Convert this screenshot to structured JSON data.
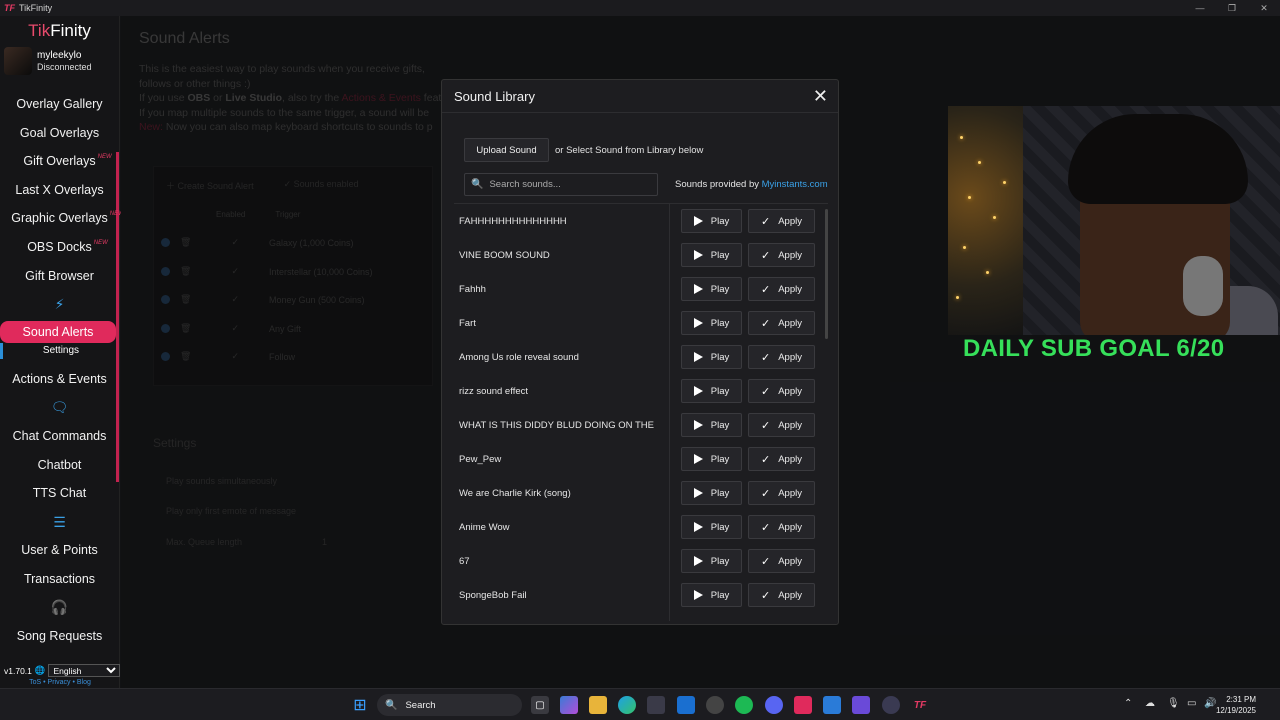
{
  "window": {
    "app_logo": "TF",
    "title": "TikFinity"
  },
  "sidebar": {
    "brand_tik": "Tik",
    "brand_finity": "Finity",
    "username": "myleekylo",
    "status": "Disconnected",
    "items": [
      {
        "label": "Overlay Gallery",
        "new": ""
      },
      {
        "label": "Goal Overlays",
        "new": ""
      },
      {
        "label": "Gift Overlays",
        "new": "NEW"
      },
      {
        "label": "Last X Overlays",
        "new": ""
      },
      {
        "label": "Graphic Overlays",
        "new": "NEW"
      },
      {
        "label": "OBS Docks",
        "new": "NEW"
      },
      {
        "label": "Gift Browser",
        "new": ""
      }
    ],
    "active_item": "Sound Alerts",
    "sub_item": "Settings",
    "items2": [
      {
        "label": "Actions & Events"
      }
    ],
    "items3": [
      {
        "label": "Chat Commands"
      },
      {
        "label": "Chatbot"
      },
      {
        "label": "TTS Chat"
      }
    ],
    "items4": [
      {
        "label": "User & Points"
      },
      {
        "label": "Transactions"
      }
    ],
    "items5": [
      {
        "label": "Song Requests"
      }
    ],
    "version": "v1.70.1",
    "language": "English",
    "link_tos": "ToS",
    "link_privacy": "Privacy",
    "link_blog": "Blog"
  },
  "background": {
    "title": "Sound Alerts",
    "desc_line1": "This is the easiest way to play sounds when you receive gifts, follows or other things :)",
    "desc_line2_a": "If you use ",
    "desc_line2_obs": "OBS",
    "desc_line2_b": " or ",
    "desc_line2_live": "Live Studio",
    "desc_line2_c": ", also try the ",
    "desc_line2_actions": "Actions & Events",
    "desc_line2_d": " feat",
    "desc_line3": "If you map multiple sounds to the same trigger, a sound will be",
    "desc_line4_new": "New:",
    "desc_line4": " Now you can also map keyboard shortcuts to sounds to p",
    "create_btn": "Create Sound Alert",
    "sounds_enabled": "Sounds enabled",
    "col_enabled": "Enabled",
    "col_trigger": "Trigger",
    "rows": [
      "Galaxy (1,000 Coins)",
      "Interstellar (10,000 Coins)",
      "Money Gun (500 Coins)",
      "Any Gift",
      "Follow"
    ],
    "settings_title": "Settings",
    "setting1": "Play sounds simultaneously",
    "setting2": "Play only first emote of message",
    "setting3": "Max. Queue length",
    "setting3_value": "1"
  },
  "modal": {
    "title": "Sound Library",
    "close": "✕",
    "upload_label": "Upload Sound",
    "or_text": "or Select Sound from Library below",
    "search_placeholder": "Search sounds...",
    "provided_text": "Sounds provided by ",
    "provided_link": "Myinstants.com",
    "play_label": "Play",
    "apply_label": "Apply",
    "sounds": [
      "FAHHHHHHHHHHHHHH",
      "VINE BOOM SOUND",
      "Fahhh",
      "Fart",
      "Among Us role reveal sound",
      "rizz sound effect",
      "WHAT IS THIS DIDDY BLUD DOING ON THE",
      "Pew_Pew",
      "We are Charlie Kirk (song)",
      "Anime Wow",
      "67",
      "SpongeBob Fail"
    ]
  },
  "stream": {
    "goal_text": "DAILY SUB GOAL 6/20"
  },
  "taskbar": {
    "search_label": "Search",
    "time": "2:31 PM",
    "date": "12/19/2025"
  }
}
